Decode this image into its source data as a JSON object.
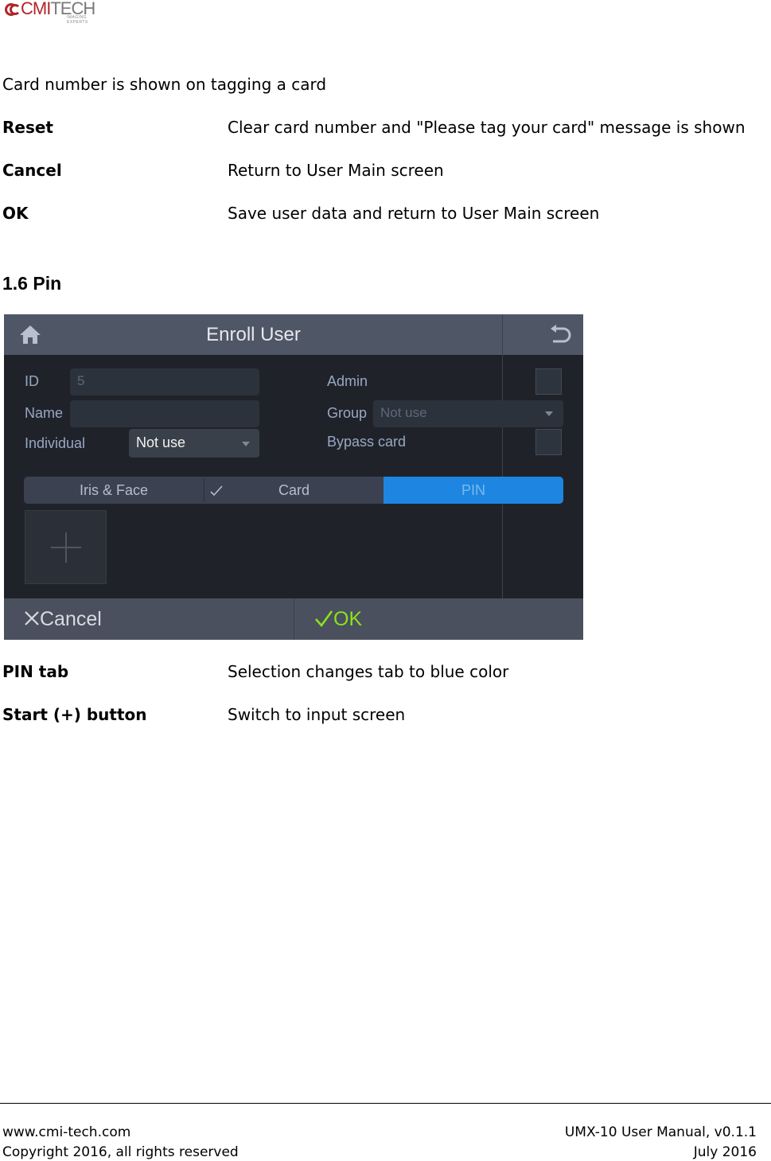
{
  "header": {
    "logo_text_primary": "CMI",
    "logo_text_secondary": "TECH",
    "logo_tagline": "IMAGING EXPERTS"
  },
  "intro": "Card number is shown on tagging a card",
  "defs1": [
    {
      "label": "Reset",
      "desc": "Clear card number and \"Please tag your card\" message is shown"
    },
    {
      "label": "Cancel",
      "desc": "Return to User Main screen"
    },
    {
      "label": "OK",
      "desc": "Save user data and return to User Main screen"
    }
  ],
  "section_heading": "1.6 Pin",
  "screen": {
    "title": "Enroll User",
    "id_label": "ID",
    "id_value": "5",
    "name_label": "Name",
    "name_value": "",
    "individual_label": "Individual",
    "individual_value": "Not use",
    "admin_label": "Admin",
    "group_label": "Group",
    "group_value": "Not use",
    "bypass_label": "Bypass card",
    "tabs": [
      "Iris & Face",
      "Card",
      "PIN"
    ],
    "active_tab": "PIN",
    "cancel_label": "Cancel",
    "ok_label": "OK",
    "colors": {
      "active_tab": "#1e86e0",
      "ok": "#8be31a"
    }
  },
  "defs2": [
    {
      "label": "PIN tab",
      "desc": "Selection changes tab to blue color"
    },
    {
      "label": "Start (+) button",
      "desc": "Switch to input screen"
    }
  ],
  "footer": {
    "website": "www.cmi-tech.com",
    "copyright": "Copyright 2016, all rights reserved",
    "doc": "UMX-10 User Manual, v0.1.1",
    "date": "July 2016"
  }
}
